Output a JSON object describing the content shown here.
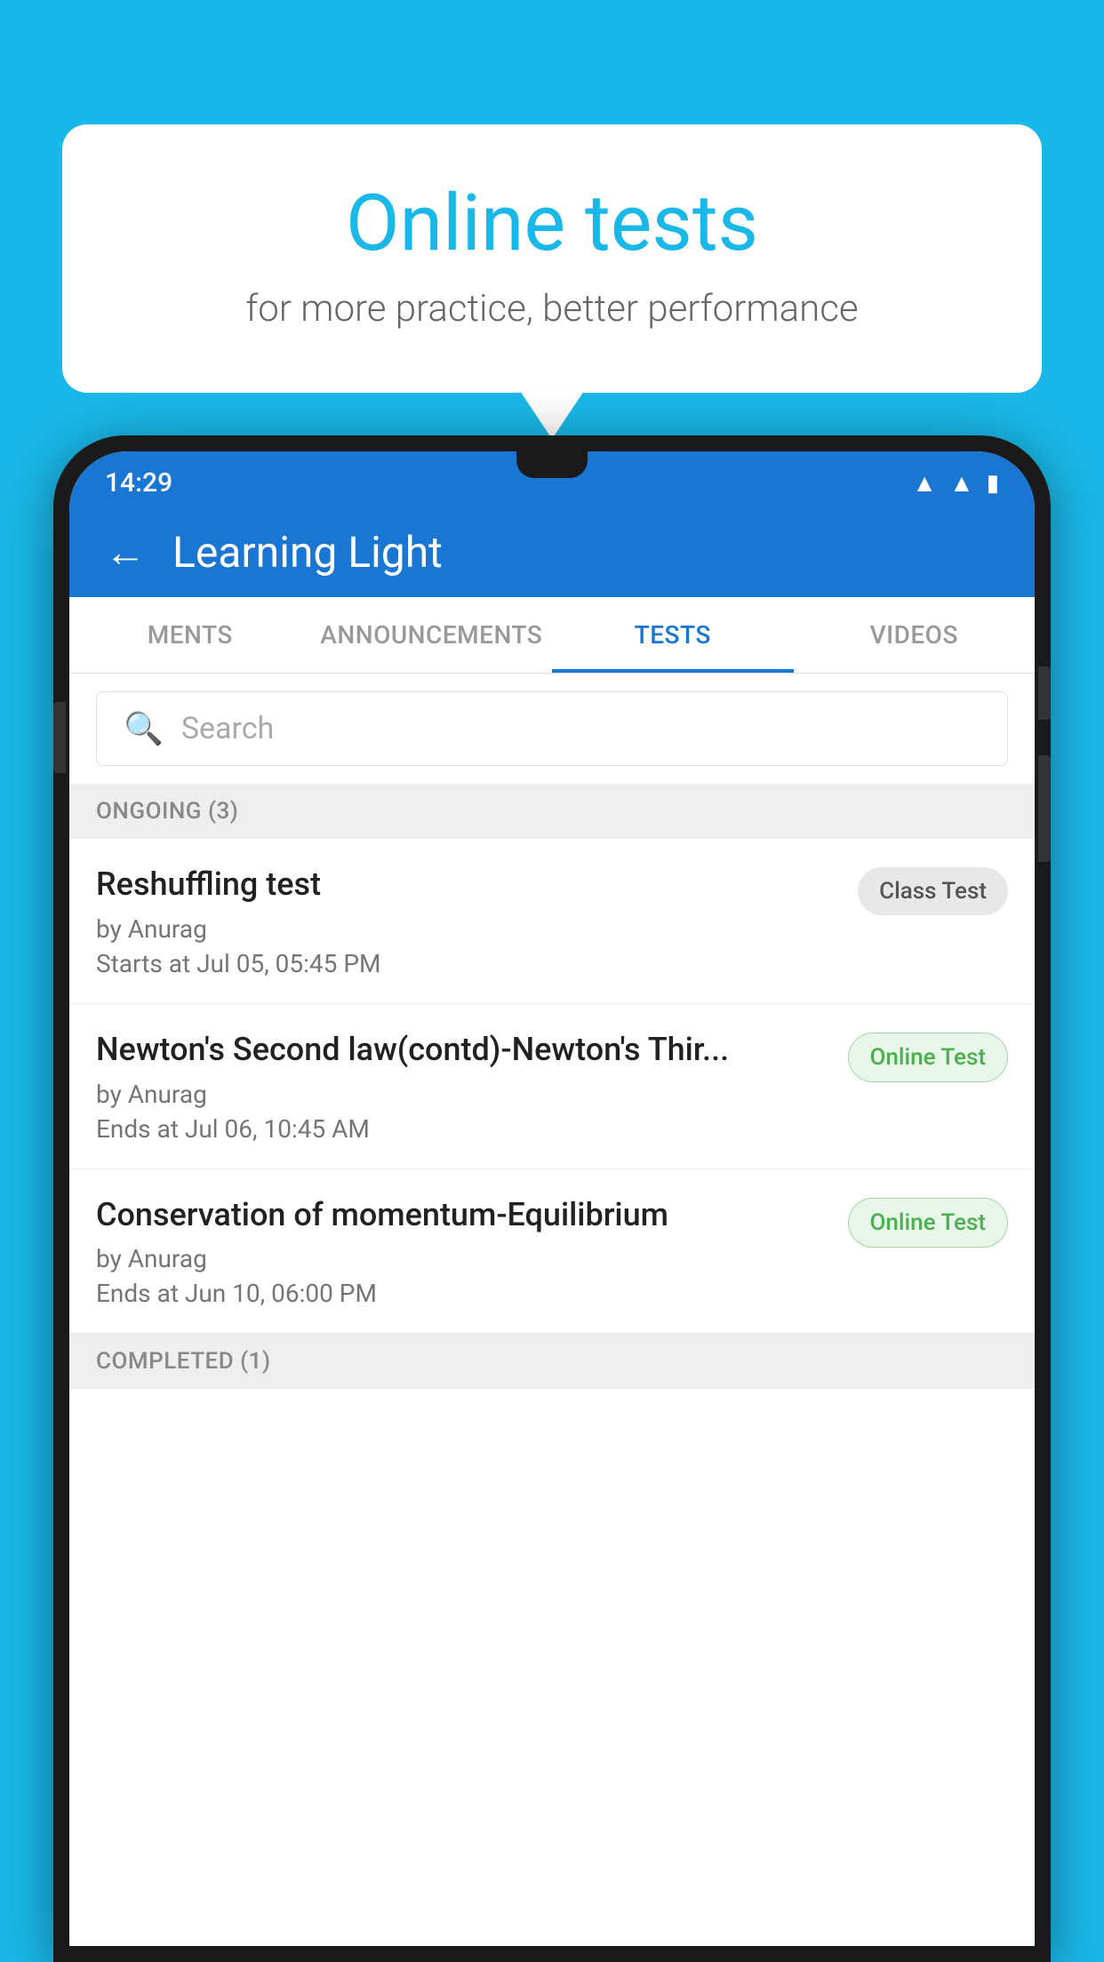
{
  "background_color": "#1ab8e8",
  "speech_bubble": {
    "title": "Online tests",
    "subtitle": "for more practice, better performance"
  },
  "status_bar": {
    "time": "14:29",
    "wifi": "▼",
    "signal": "◀",
    "battery": "▮"
  },
  "app_bar": {
    "title": "Learning Light",
    "back_label": "←"
  },
  "tabs": [
    {
      "label": "MENTS",
      "active": false
    },
    {
      "label": "ANNOUNCEMENTS",
      "active": false
    },
    {
      "label": "TESTS",
      "active": true
    },
    {
      "label": "VIDEOS",
      "active": false
    }
  ],
  "search": {
    "placeholder": "Search"
  },
  "ongoing_section": {
    "label": "ONGOING (3)"
  },
  "tests": [
    {
      "name": "Reshuffling test",
      "by": "by Anurag",
      "date": "Starts at  Jul 05, 05:45 PM",
      "badge_label": "Class Test",
      "badge_type": "class"
    },
    {
      "name": "Newton's Second law(contd)-Newton's Thir...",
      "by": "by Anurag",
      "date": "Ends at  Jul 06, 10:45 AM",
      "badge_label": "Online Test",
      "badge_type": "online"
    },
    {
      "name": "Conservation of momentum-Equilibrium",
      "by": "by Anurag",
      "date": "Ends at  Jun 10, 06:00 PM",
      "badge_label": "Online Test",
      "badge_type": "online"
    }
  ],
  "completed_section": {
    "label": "COMPLETED (1)"
  }
}
